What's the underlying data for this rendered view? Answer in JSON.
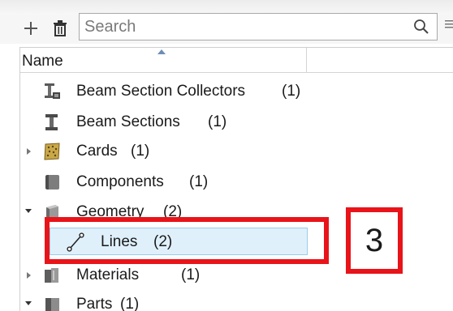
{
  "toolbar": {
    "add_icon": "plus-icon",
    "delete_icon": "trash-icon",
    "search_placeholder": "Search",
    "search_icon": "magnifier-icon"
  },
  "tree": {
    "header": {
      "name": "Name"
    },
    "rows": [
      {
        "label": "Beam Section Collectors",
        "count": "(1)",
        "icon": "beam-section-collector-icon",
        "expander": "none"
      },
      {
        "label": "Beam Sections",
        "count": "(1)",
        "icon": "beam-section-icon",
        "expander": "none"
      },
      {
        "label": "Cards",
        "count": "(1)",
        "icon": "cards-icon",
        "expander": "collapsed"
      },
      {
        "label": "Components",
        "count": "(1)",
        "icon": "component-icon",
        "expander": "none"
      },
      {
        "label": "Geometry",
        "count": "(2)",
        "icon": "geometry-icon",
        "expander": "expanded"
      },
      {
        "label": "Lines",
        "count": "(2)",
        "icon": "line-icon",
        "expander": "none",
        "selected": true
      },
      {
        "label": "Materials",
        "count": "(1)",
        "icon": "materials-icon",
        "expander": "collapsed"
      },
      {
        "label": "Parts",
        "count": "(1)",
        "icon": "parts-icon",
        "expander": "expanded"
      }
    ]
  },
  "annotation": {
    "step_number": "3",
    "color": "#e8141a"
  },
  "colors": {
    "selection_fill": "#dff0fb",
    "selection_border": "#99cdec"
  }
}
